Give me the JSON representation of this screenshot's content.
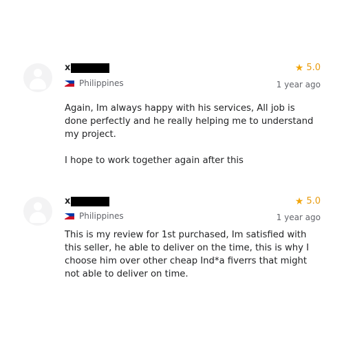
{
  "reviews": [
    {
      "username": "x",
      "country": "Philippines",
      "rating": "5.0",
      "date": "1 year ago",
      "paragraphs": [
        "Again, Im always happy with his services, All job is done perfectly and he really helping me to understand my project.",
        "I hope to work together again after this"
      ]
    },
    {
      "username": "x",
      "country": "Philippines",
      "rating": "5.0",
      "date": "1 year ago",
      "paragraphs": [
        "This is my review for 1st purchased, Im satisfied with this seller, he able to deliver on the time, this is why I choose him over other cheap Ind*a fiverrs that might not able to deliver on time."
      ]
    }
  ],
  "icons": {
    "avatar": "default-user-avatar-icon",
    "star": "star-icon",
    "flag": "philippines-flag-icon"
  },
  "colors": {
    "star": "#f2a50a",
    "rating_text": "#e89b0f",
    "muted": "#62646a"
  }
}
